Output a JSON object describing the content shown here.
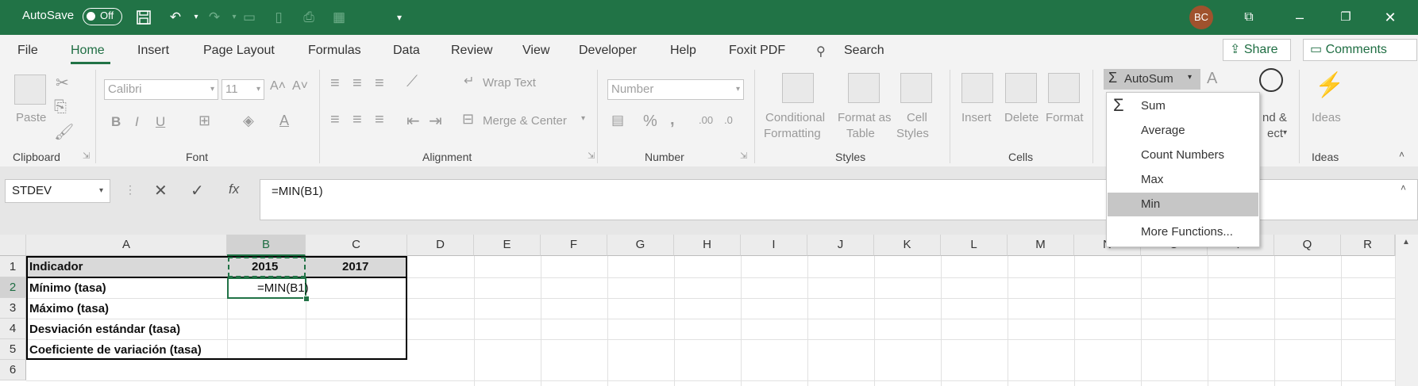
{
  "titlebar": {
    "autosave_label": "AutoSave",
    "autosave_state": "Off",
    "user_initials": "BC"
  },
  "tabs": [
    "File",
    "Home",
    "Insert",
    "Page Layout",
    "Formulas",
    "Data",
    "Review",
    "View",
    "Developer",
    "Help",
    "Foxit PDF"
  ],
  "search_label": "Search",
  "share_label": "Share",
  "comments_label": "Comments",
  "ribbon": {
    "paste_label": "Paste",
    "clipboard_group": "Clipboard",
    "font_name": "Calibri",
    "font_size": "11",
    "font_group": "Font",
    "wrap_text": "Wrap Text",
    "merge_center": "Merge & Center",
    "alignment_group": "Alignment",
    "number_format": "Number",
    "number_group": "Number",
    "conditional_1": "Conditional",
    "conditional_2": "Formatting",
    "format_table_1": "Format as",
    "format_table_2": "Table",
    "cell_styles_1": "Cell",
    "cell_styles_2": "Styles",
    "styles_group": "Styles",
    "insert_label": "Insert",
    "delete_label": "Delete",
    "format_label": "Format",
    "cells_group": "Cells",
    "autosum_label": "AutoSum",
    "find_select_1": "nd &",
    "find_select_2": "ect",
    "ideas_label": "Ideas",
    "ideas_group": "Ideas"
  },
  "autosum_menu": [
    "Sum",
    "Average",
    "Count Numbers",
    "Max",
    "Min",
    "More Functions..."
  ],
  "autosum_selected": "Min",
  "formula_bar": {
    "name_box": "STDEV",
    "formula": "=MIN(B1)"
  },
  "columns": [
    "A",
    "B",
    "C",
    "D",
    "E",
    "F",
    "G",
    "H",
    "I",
    "J",
    "K",
    "L",
    "M",
    "N",
    "O",
    "P",
    "Q",
    "R"
  ],
  "rows": [
    "1",
    "2",
    "3",
    "4",
    "5",
    "6"
  ],
  "cells": {
    "A1": "Indicador",
    "B1": "2015",
    "C1": "2017",
    "A2": "Mínimo (tasa)",
    "B2": "=MIN(B1)",
    "A3": "Máximo (tasa)",
    "A4": "Desviación estándar (tasa)",
    "A5": "Coeficiente de variación  (tasa)"
  },
  "colors": {
    "excel_green": "#217346",
    "menu_highlight": "#c6c6c6",
    "header_fill": "#d9d9d9"
  }
}
